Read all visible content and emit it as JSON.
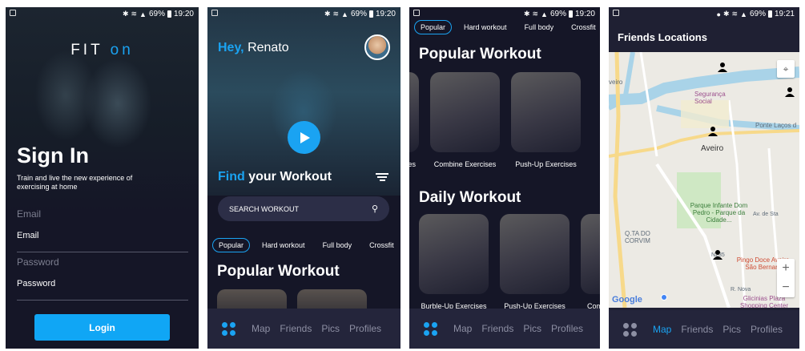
{
  "status_1": {
    "battery": "69%",
    "time": "19:20"
  },
  "status_2": {
    "battery": "69%",
    "time": "19:20"
  },
  "status_3": {
    "battery": "69%",
    "time": "19:20"
  },
  "status_4": {
    "battery": "69%",
    "time": "19:21"
  },
  "signin": {
    "brand_fit": "FIT",
    "brand_on": "on",
    "title": "Sign In",
    "tagline": "Train and live the new experience of exercising at home",
    "email_label": "Email",
    "email_value": "Email",
    "password_label": "Password",
    "password_value": "Password",
    "login_label": "Login"
  },
  "home": {
    "greeting_hey": "Hey,",
    "greeting_name": "Renato",
    "find_hl": "Find",
    "find_rest": "your Workout",
    "search_placeholder": "SEARCH WORKOUT",
    "chips": [
      "Popular",
      "Hard workout",
      "Full body",
      "Crossfit"
    ],
    "popular_title": "Popular Workout"
  },
  "workouts": {
    "chips": [
      "Popular",
      "Hard workout",
      "Full body",
      "Crossfit"
    ],
    "popular_title": "Popular Workout",
    "popular_items": [
      "ises",
      "Combine Exercises",
      "Push-Up Exercises"
    ],
    "daily_title": "Daily Workout",
    "daily_items": [
      "Burble-Up Exercises",
      "Push-Up Exercises",
      "Comb"
    ]
  },
  "map_screen": {
    "title": "Friends Locations",
    "places": {
      "aveiro_label": "Aveiro",
      "seguranca": "Segurança Social",
      "ponte": "Ponte Laços d",
      "aveiro_edge": "veiro",
      "parque": "Parque Infante Dom Pedro - Parque da Cidade...",
      "qta": "Q.TA DO CORVIM",
      "pingo": "Pingo Doce Aveiro - São Bernardo",
      "glicinias": "Glicinias Plaza Shopping Center",
      "road_n235": "N235",
      "rua_nova": "R. Nova",
      "av_sta": "Av. de Sta"
    },
    "google": "Google"
  },
  "nav": {
    "map": "Map",
    "friends": "Friends",
    "pics": "Pics",
    "profiles": "Profiles"
  },
  "colors": {
    "accent": "#1aa3f2",
    "background": "#151627",
    "nav_bg": "#24253b"
  }
}
